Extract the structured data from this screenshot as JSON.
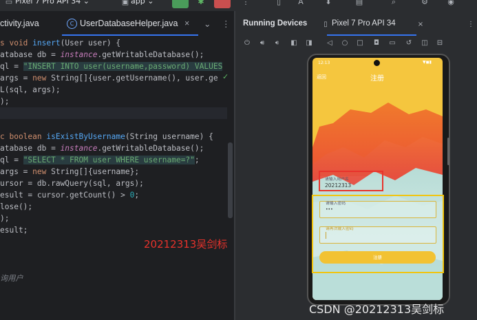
{
  "toolbar": {
    "device": "Pixel 7 Pro API 34",
    "app": "app",
    "device_chevron": "⌄",
    "app_chevron": "⌄"
  },
  "editor": {
    "tabs": [
      {
        "label": "ctivity.java"
      },
      {
        "label": "UserDatabaseHelper.java",
        "close": "×"
      }
    ],
    "more_tabs": "⌄",
    "menu": "⋮",
    "class_badge": "C",
    "status_check": "✓"
  },
  "code": {
    "l1_kw": "s void ",
    "l1_fn": "insert",
    "l1_rest": "(User user) {",
    "l2_a": "atabase db = ",
    "l2_it": "instance",
    "l2_b": ".getWritableDatabase();",
    "l3_a": "ql = ",
    "l3_str": "\"INSERT INTO user(username,password) VALUES",
    "l4_a": "args = ",
    "l4_kw": "new ",
    "l4_b": "String[]{user.getUsername(), user.ge",
    "l5": "L(sql, args);",
    "l6": ");",
    "l9_kw": "c boolean ",
    "l9_fn": "isExistByUsername",
    "l9_rest": "(String username) {",
    "l10_a": "atabase db = ",
    "l10_it": "instance",
    "l10_b": ".getWritableDatabase();",
    "l11_a": "ql = ",
    "l11_str": "\"SELECT * FROM user WHERE username=?\"",
    "l11_b": ";",
    "l12_a": "args = ",
    "l12_kw": "new ",
    "l12_b": "String[]{username};",
    "l13": "ursor = db.rawQuery(sql, args);",
    "l14_a": "esult = cursor.getCount() > ",
    "l14_num": "0",
    "l14_b": ";",
    "l15": "lose();",
    "l16": ");",
    "l17": "esult;",
    "l20": "询用户"
  },
  "running_devices": {
    "title": "Running Devices",
    "tab": "Pixel 7 Pro API 34",
    "tab_close": "×",
    "menu": "⋮"
  },
  "phone": {
    "time": "12:13",
    "back": "返回",
    "title": "注册",
    "username_label": "请输入用户名",
    "username_value": "20212313",
    "password_label": "请输入密码",
    "password_value": "•••",
    "confirm_label": "请再次输入密码",
    "register_button": "注册"
  },
  "annotations": {
    "watermark": "20212313吴剑标",
    "csdn": "CSDN @20212313吴剑标"
  }
}
